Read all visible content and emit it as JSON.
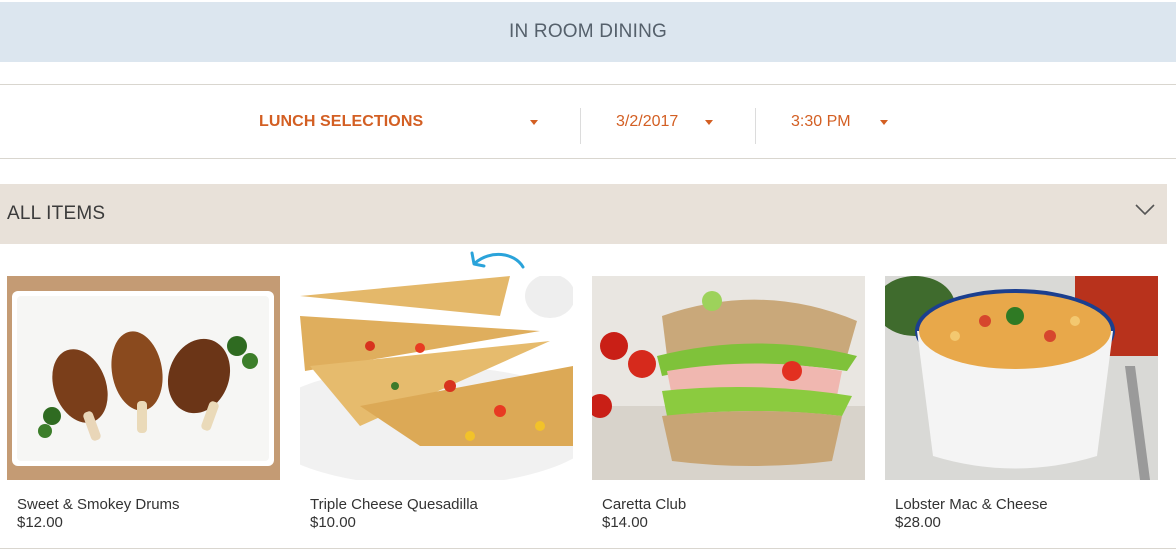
{
  "header": {
    "title": "IN ROOM DINING"
  },
  "filters": {
    "meal": {
      "label": "LUNCH SELECTIONS"
    },
    "date": {
      "label": "3/2/2017"
    },
    "time": {
      "label": "3:30 PM"
    }
  },
  "category": {
    "title": "ALL ITEMS"
  },
  "items": [
    {
      "name": "Sweet & Smokey Drums",
      "price": "$12.00"
    },
    {
      "name": "Triple Cheese Quesadilla",
      "price": "$10.00"
    },
    {
      "name": "Caretta Club",
      "price": "$14.00"
    },
    {
      "name": "Lobster Mac & Cheese",
      "price": "$28.00"
    }
  ],
  "colors": {
    "accent": "#d35f23",
    "header_bg": "#dce6ef",
    "category_bg": "#e8e1d9",
    "refresh": "#2aa3da"
  },
  "icons": {
    "dropdown": "caret-down-icon",
    "collapse": "chevron-down-icon",
    "refresh": "refresh-arrow-icon"
  }
}
